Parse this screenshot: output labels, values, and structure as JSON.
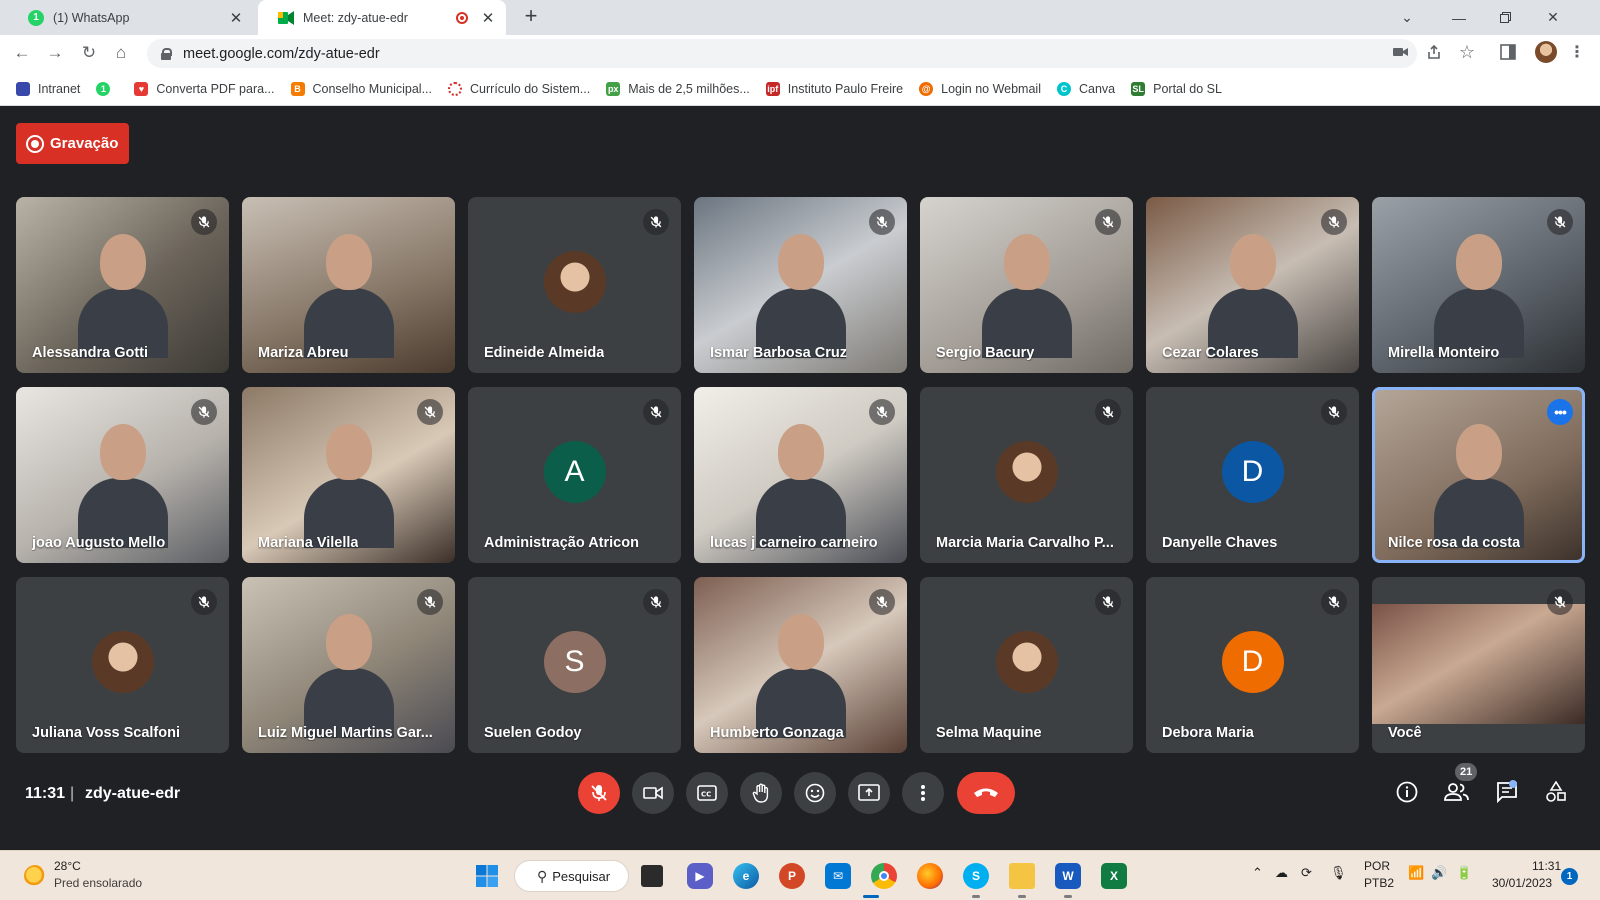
{
  "browser": {
    "tabs": [
      {
        "label": "(1) WhatsApp",
        "favicon_badge": "1",
        "active": false
      },
      {
        "label": "Meet: zdy-atue-edr",
        "active": true,
        "recording": true
      }
    ],
    "url": "meet.google.com/zdy-atue-edr",
    "bookmarks": [
      {
        "label": "Intranet",
        "icon": "intranet-icon",
        "color": "#1a73e8"
      },
      {
        "label": "",
        "icon": "whatsapp-icon",
        "color": "#25d366"
      },
      {
        "label": "Converta PDF para...",
        "icon": "pdf-heart-icon",
        "color": "#e53935"
      },
      {
        "label": "Conselho Municipal...",
        "icon": "blogger-icon",
        "color": "#f57c00"
      },
      {
        "label": "Currículo do Sistem...",
        "icon": "spinner-icon",
        "color": "#d32f2f"
      },
      {
        "label": "Mais de 2,5 milhões...",
        "icon": "px-icon",
        "color": "#43a047"
      },
      {
        "label": "Instituto Paulo Freire",
        "icon": "ipf-icon",
        "color": "#c62828"
      },
      {
        "label": "Login no Webmail",
        "icon": "webmail-icon",
        "color": "#ef6c00"
      },
      {
        "label": "Canva",
        "icon": "canva-icon",
        "color": "#00c4cc"
      },
      {
        "label": "Portal do SL",
        "icon": "portal-icon",
        "color": "#2e7d32"
      }
    ]
  },
  "meet": {
    "recording_label": "Gravação",
    "clock": "11:31",
    "separator": "|",
    "meeting_code": "zdy-atue-edr",
    "participant_count": "21",
    "participants": [
      {
        "name": "Alessandra Gotti",
        "kind": "video",
        "style": "v1",
        "muted": true
      },
      {
        "name": "Mariza Abreu",
        "kind": "video",
        "style": "v2",
        "muted": false
      },
      {
        "name": "Edineide Almeida",
        "kind": "photo",
        "muted": true
      },
      {
        "name": "Ismar Barbosa Cruz",
        "kind": "video",
        "style": "v3",
        "muted": true
      },
      {
        "name": "Sergio Bacury",
        "kind": "video",
        "style": "v4",
        "muted": true
      },
      {
        "name": "Cezar Colares",
        "kind": "video",
        "style": "v5",
        "muted": true
      },
      {
        "name": "Mirella Monteiro",
        "kind": "video",
        "style": "v6",
        "muted": true
      },
      {
        "name": "joao Augusto Mello",
        "kind": "video",
        "style": "v7",
        "muted": true
      },
      {
        "name": "Mariana Vilella",
        "kind": "video",
        "style": "v8",
        "muted": true
      },
      {
        "name": "Administração Atricon",
        "kind": "letter",
        "letter": "A",
        "color": "#0b5f4a",
        "muted": true
      },
      {
        "name": "lucas j carneiro carneiro",
        "kind": "video",
        "style": "v9",
        "muted": true
      },
      {
        "name": "Marcia Maria Carvalho P...",
        "kind": "photo",
        "muted": true
      },
      {
        "name": "Danyelle Chaves",
        "kind": "letter",
        "letter": "D",
        "color": "#0b57a4",
        "muted": true
      },
      {
        "name": "Nilce rosa da costa",
        "kind": "video",
        "style": "v10",
        "muted": false,
        "speaking": true
      },
      {
        "name": "Juliana Voss Scalfoni",
        "kind": "photo",
        "muted": true
      },
      {
        "name": "Luiz Miguel Martins Gar...",
        "kind": "video",
        "style": "v11",
        "muted": true
      },
      {
        "name": "Suelen Godoy",
        "kind": "letter",
        "letter": "S",
        "color": "#8d6e63",
        "muted": true
      },
      {
        "name": "Humberto Gonzaga",
        "kind": "video",
        "style": "v12",
        "muted": true
      },
      {
        "name": "Selma Maquine",
        "kind": "photo",
        "muted": true
      },
      {
        "name": "Debora Maria",
        "kind": "letter",
        "letter": "D",
        "color": "#ef6c00",
        "muted": true
      },
      {
        "name": "Você",
        "kind": "self",
        "muted": true
      }
    ]
  },
  "taskbar": {
    "weather_temp": "28°C",
    "weather_desc": "Pred ensolarado",
    "search_label": "Pesquisar",
    "lang_line1": "POR",
    "lang_line2": "PTB2",
    "time": "11:31",
    "date": "30/01/2023",
    "notification_count": "1"
  }
}
